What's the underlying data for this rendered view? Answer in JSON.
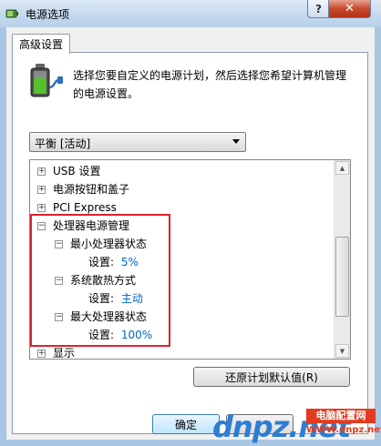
{
  "window": {
    "title": "电源选项",
    "help_button": "?",
    "close_button": "✕"
  },
  "tabs": [
    {
      "label": "高级设置"
    }
  ],
  "description": {
    "line1": "选择您要自定义的电源计划，然后选择您希望计算机管理",
    "line2": "的电源设置。"
  },
  "plan_select": {
    "value": "平衡 [活动]"
  },
  "tree": {
    "items": [
      {
        "expander": "+",
        "label": "USB 设置"
      },
      {
        "expander": "+",
        "label": "电源按钮和盖子"
      },
      {
        "expander": "+",
        "label": "PCI Express"
      },
      {
        "expander": "−",
        "label": "处理器电源管理"
      },
      {
        "expander": "−",
        "label": "最小处理器状态"
      },
      {
        "label": "设置:",
        "value": "5%"
      },
      {
        "expander": "−",
        "label": "系统散热方式"
      },
      {
        "label": "设置:",
        "value": "主动"
      },
      {
        "expander": "−",
        "label": "最大处理器状态"
      },
      {
        "label": "设置:",
        "value": "100%"
      },
      {
        "expander": "+",
        "label": "显示"
      }
    ]
  },
  "buttons": {
    "restore_defaults": "还原计划默认值(R)",
    "ok": "确定",
    "cancel": ""
  },
  "watermark": {
    "logo": "dnpz.net",
    "badge": "电脑配置网",
    "url": "WWW.dnpz.net"
  },
  "colors": {
    "highlight_box": "#e3202a",
    "setting_value": "#0066cc",
    "close_button": "#c7492c"
  }
}
